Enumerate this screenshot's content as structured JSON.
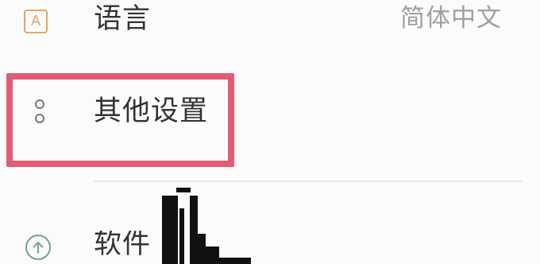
{
  "settings": {
    "language": {
      "label": "语言",
      "value": "简体中文",
      "icon": "language-icon",
      "icon_text": "A"
    },
    "other_settings": {
      "label": "其他设置",
      "icon": "more-options-icon"
    },
    "software_update": {
      "label": "软件",
      "icon": "upload-icon"
    }
  },
  "colors": {
    "accent": "#e05c72",
    "language_icon": "#e2a765",
    "update_icon": "#6fa68d",
    "text": "#333333",
    "secondary_text": "#a0a0a0",
    "background": "#fbfbfb"
  }
}
